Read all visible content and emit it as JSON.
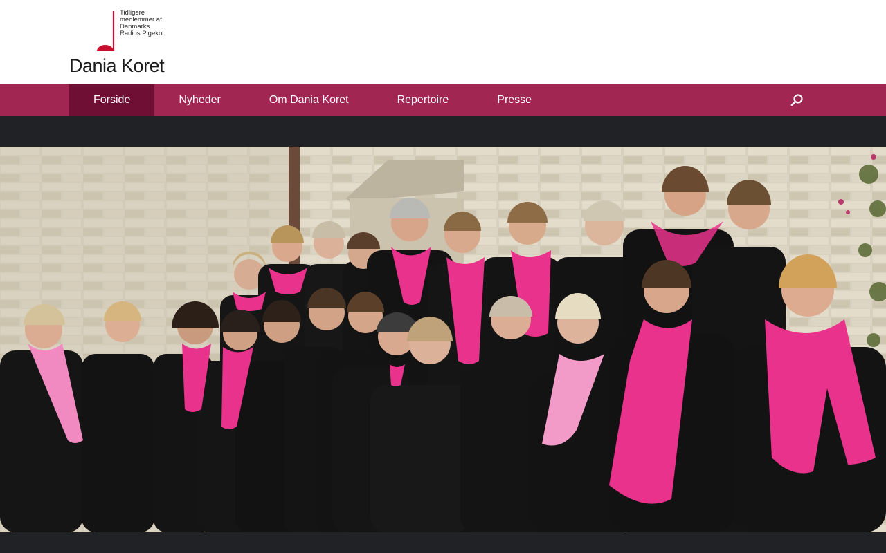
{
  "header": {
    "logo_name": "Dania Koret",
    "logo_tagline": "Tidligere\nmedlemmer af\nDanmarks\nRadios Pigekor"
  },
  "nav": {
    "items": [
      {
        "label": "Forside",
        "active": true
      },
      {
        "label": "Nyheder",
        "active": false
      },
      {
        "label": "Om Dania Koret",
        "active": false
      },
      {
        "label": "Repertoire",
        "active": false
      },
      {
        "label": "Presse",
        "active": false
      }
    ],
    "search_icon": "search-icon"
  },
  "colors": {
    "nav_bg": "#a22652",
    "nav_active": "#6f0f34",
    "dark_band": "#212226",
    "scarf_pink": "#e8328c",
    "logo_red": "#c8102e"
  },
  "hero": {
    "description_icon": "choir-group-photo"
  }
}
